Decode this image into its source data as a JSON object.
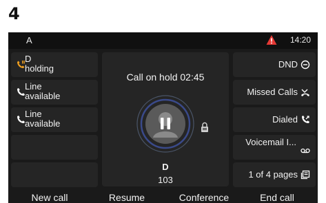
{
  "figure_label": "4",
  "status_bar": {
    "account": "A",
    "alert_icon": "warning-icon",
    "time": "14:20",
    "alert_color": "#e53935"
  },
  "lines": [
    {
      "line1": "D",
      "line2": "holding",
      "icon": "phone-hold-icon",
      "icon_color": "#f0a020"
    },
    {
      "line1": "Line",
      "line2": "available",
      "icon": "phone-icon",
      "icon_color": "#ffffff"
    },
    {
      "line1": "Line",
      "line2": "available",
      "icon": "phone-icon",
      "icon_color": "#ffffff"
    },
    {
      "line1": "",
      "line2": ""
    },
    {
      "line1": "",
      "line2": ""
    }
  ],
  "call": {
    "status": "Call on hold 02:45",
    "name": "D",
    "number": "103"
  },
  "features": [
    {
      "label": "DND",
      "icon": "dnd-icon"
    },
    {
      "label": "Missed Calls",
      "icon": "missed-calls-icon"
    },
    {
      "label": "Dialed",
      "icon": "dialed-calls-icon"
    },
    {
      "label": "Voicemail I...",
      "icon": "voicemail-icon"
    },
    {
      "label": "1 of 4 pages",
      "icon": "pages-icon"
    }
  ],
  "softkeys": [
    "New call",
    "Resume",
    "Conference",
    "End call"
  ]
}
